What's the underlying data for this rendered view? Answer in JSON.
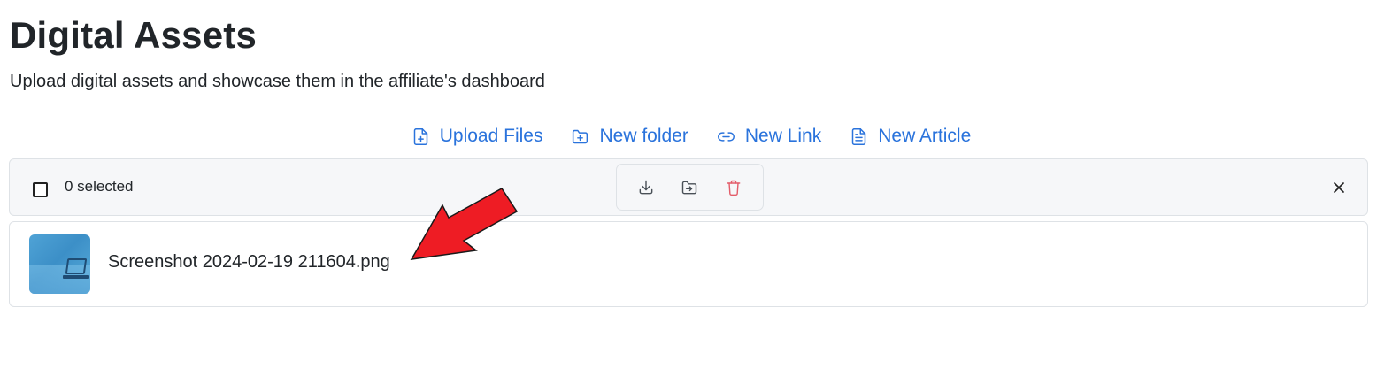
{
  "header": {
    "title": "Digital Assets",
    "subtitle": "Upload digital assets and showcase them in the affiliate's dashboard"
  },
  "actions": [
    {
      "label": "Upload Files",
      "icon": "file-plus-icon"
    },
    {
      "label": "New folder",
      "icon": "folder-plus-icon"
    },
    {
      "label": "New Link",
      "icon": "link-icon"
    },
    {
      "label": "New Article",
      "icon": "file-text-icon"
    }
  ],
  "selection_bar": {
    "selected_text": "0 selected",
    "checked": false,
    "tools": [
      {
        "name": "download",
        "icon": "download-icon",
        "color": "#495057"
      },
      {
        "name": "move",
        "icon": "folder-move-icon",
        "color": "#495057"
      },
      {
        "name": "delete",
        "icon": "trash-icon",
        "color": "#e35d6a"
      }
    ],
    "close_icon": "close-icon"
  },
  "files": [
    {
      "name": "Screenshot 2024-02-19 211604.png",
      "thumbnail_icon": "image-thumbnail"
    }
  ],
  "colors": {
    "accent": "#2a73dc",
    "danger": "#e35d6a",
    "annotation_arrow": "#ee1c24"
  }
}
